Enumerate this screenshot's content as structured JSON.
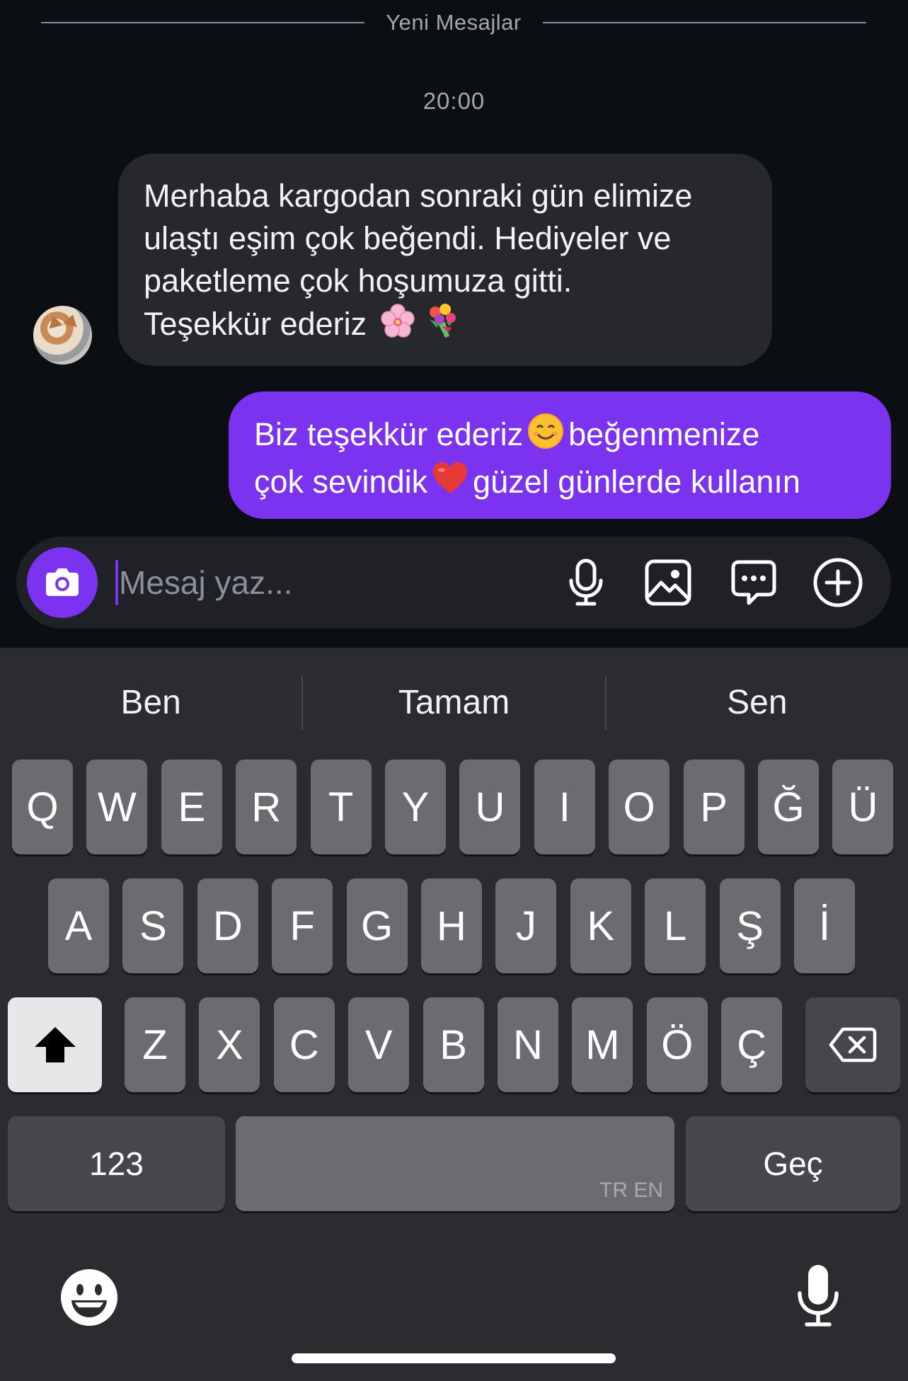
{
  "chat": {
    "divider_text": "Yeni Mesajlar",
    "timestamp": "20:00",
    "incoming": {
      "lines": [
        "Merhaba kargodan sonraki gün elimize",
        "ulaştı eşim çok beğendi. Hediyeler ve",
        "paketleme çok hoşumuza gitti.",
        "Teşekkür ederiz"
      ],
      "emojis": [
        "cherry-blossom",
        "bouquet"
      ]
    },
    "outgoing": {
      "line1_a": "Biz teşekkür ederiz",
      "line1_b": "beğenmenize",
      "line2_a": "çok sevindik",
      "line2_b": "güzel günlerde kullanın",
      "emojis": [
        "smiling-face",
        "red-heart"
      ]
    }
  },
  "composer": {
    "placeholder": "Mesaj yaz...",
    "accent_color": "#7b33f0",
    "icons": [
      "camera-icon",
      "microphone-icon",
      "gallery-icon",
      "sticker-chat-icon",
      "add-icon"
    ]
  },
  "keyboard": {
    "suggestions": [
      "Ben",
      "Tamam",
      "Sen"
    ],
    "row1": [
      "Q",
      "W",
      "E",
      "R",
      "T",
      "Y",
      "U",
      "I",
      "O",
      "P",
      "Ğ",
      "Ü"
    ],
    "row2": [
      "A",
      "S",
      "D",
      "F",
      "G",
      "H",
      "J",
      "K",
      "L",
      "Ş",
      "İ"
    ],
    "row3": [
      "Z",
      "X",
      "C",
      "V",
      "B",
      "N",
      "M",
      "Ö",
      "Ç"
    ],
    "numbers_label": "123",
    "space_lang": "TR EN",
    "return_label": "Geç",
    "icons": [
      "shift-icon",
      "backspace-icon",
      "emoji-icon",
      "dictation-icon"
    ]
  }
}
